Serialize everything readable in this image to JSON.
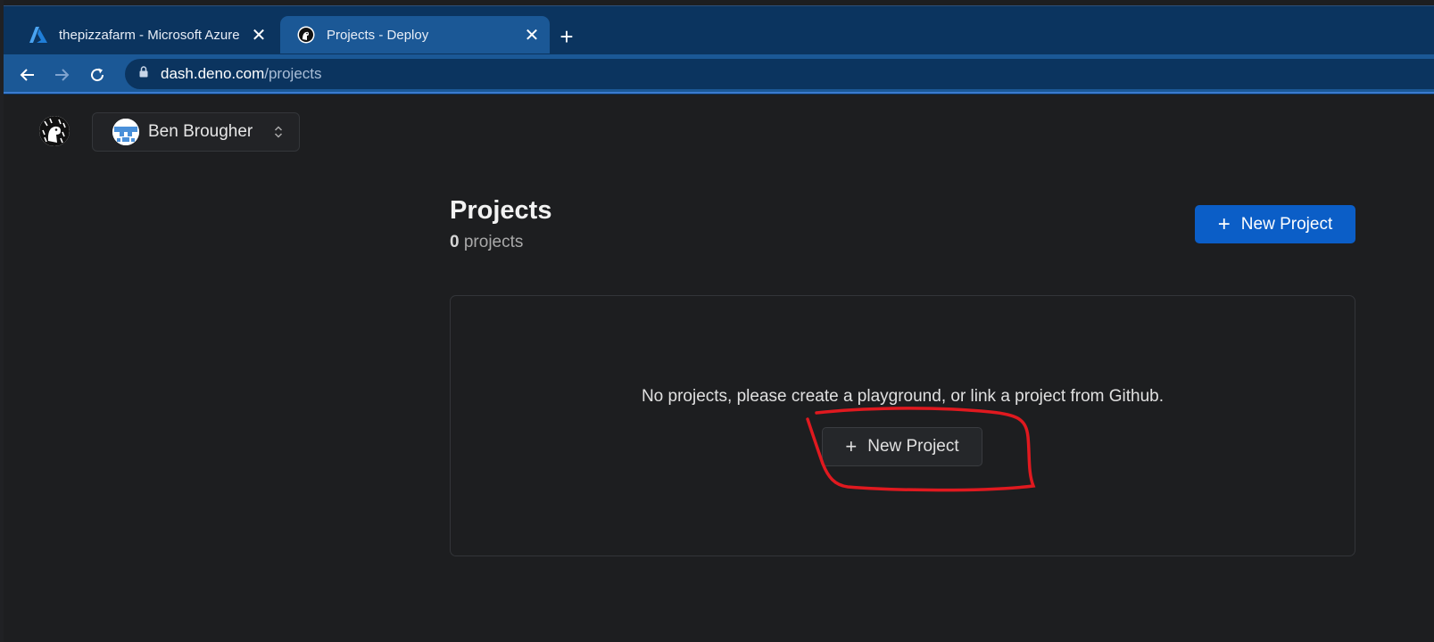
{
  "browser": {
    "tabs": [
      {
        "title": "thepizzafarm - Microsoft Azure",
        "favicon": "azure-icon",
        "active": false
      },
      {
        "title": "Projects - Deploy",
        "favicon": "deno-icon",
        "active": true
      }
    ],
    "url_host": "dash.deno.com",
    "url_path": "/projects"
  },
  "header": {
    "user_name": "Ben Brougher"
  },
  "main": {
    "title": "Projects",
    "project_count": "0",
    "project_count_label": "projects",
    "new_project_label": "New Project"
  },
  "empty_state": {
    "message": "No projects, please create a playground, or link a project from Github.",
    "button_label": "New Project"
  },
  "colors": {
    "primary": "#0b5ec7",
    "annotation": "#e0191f"
  }
}
